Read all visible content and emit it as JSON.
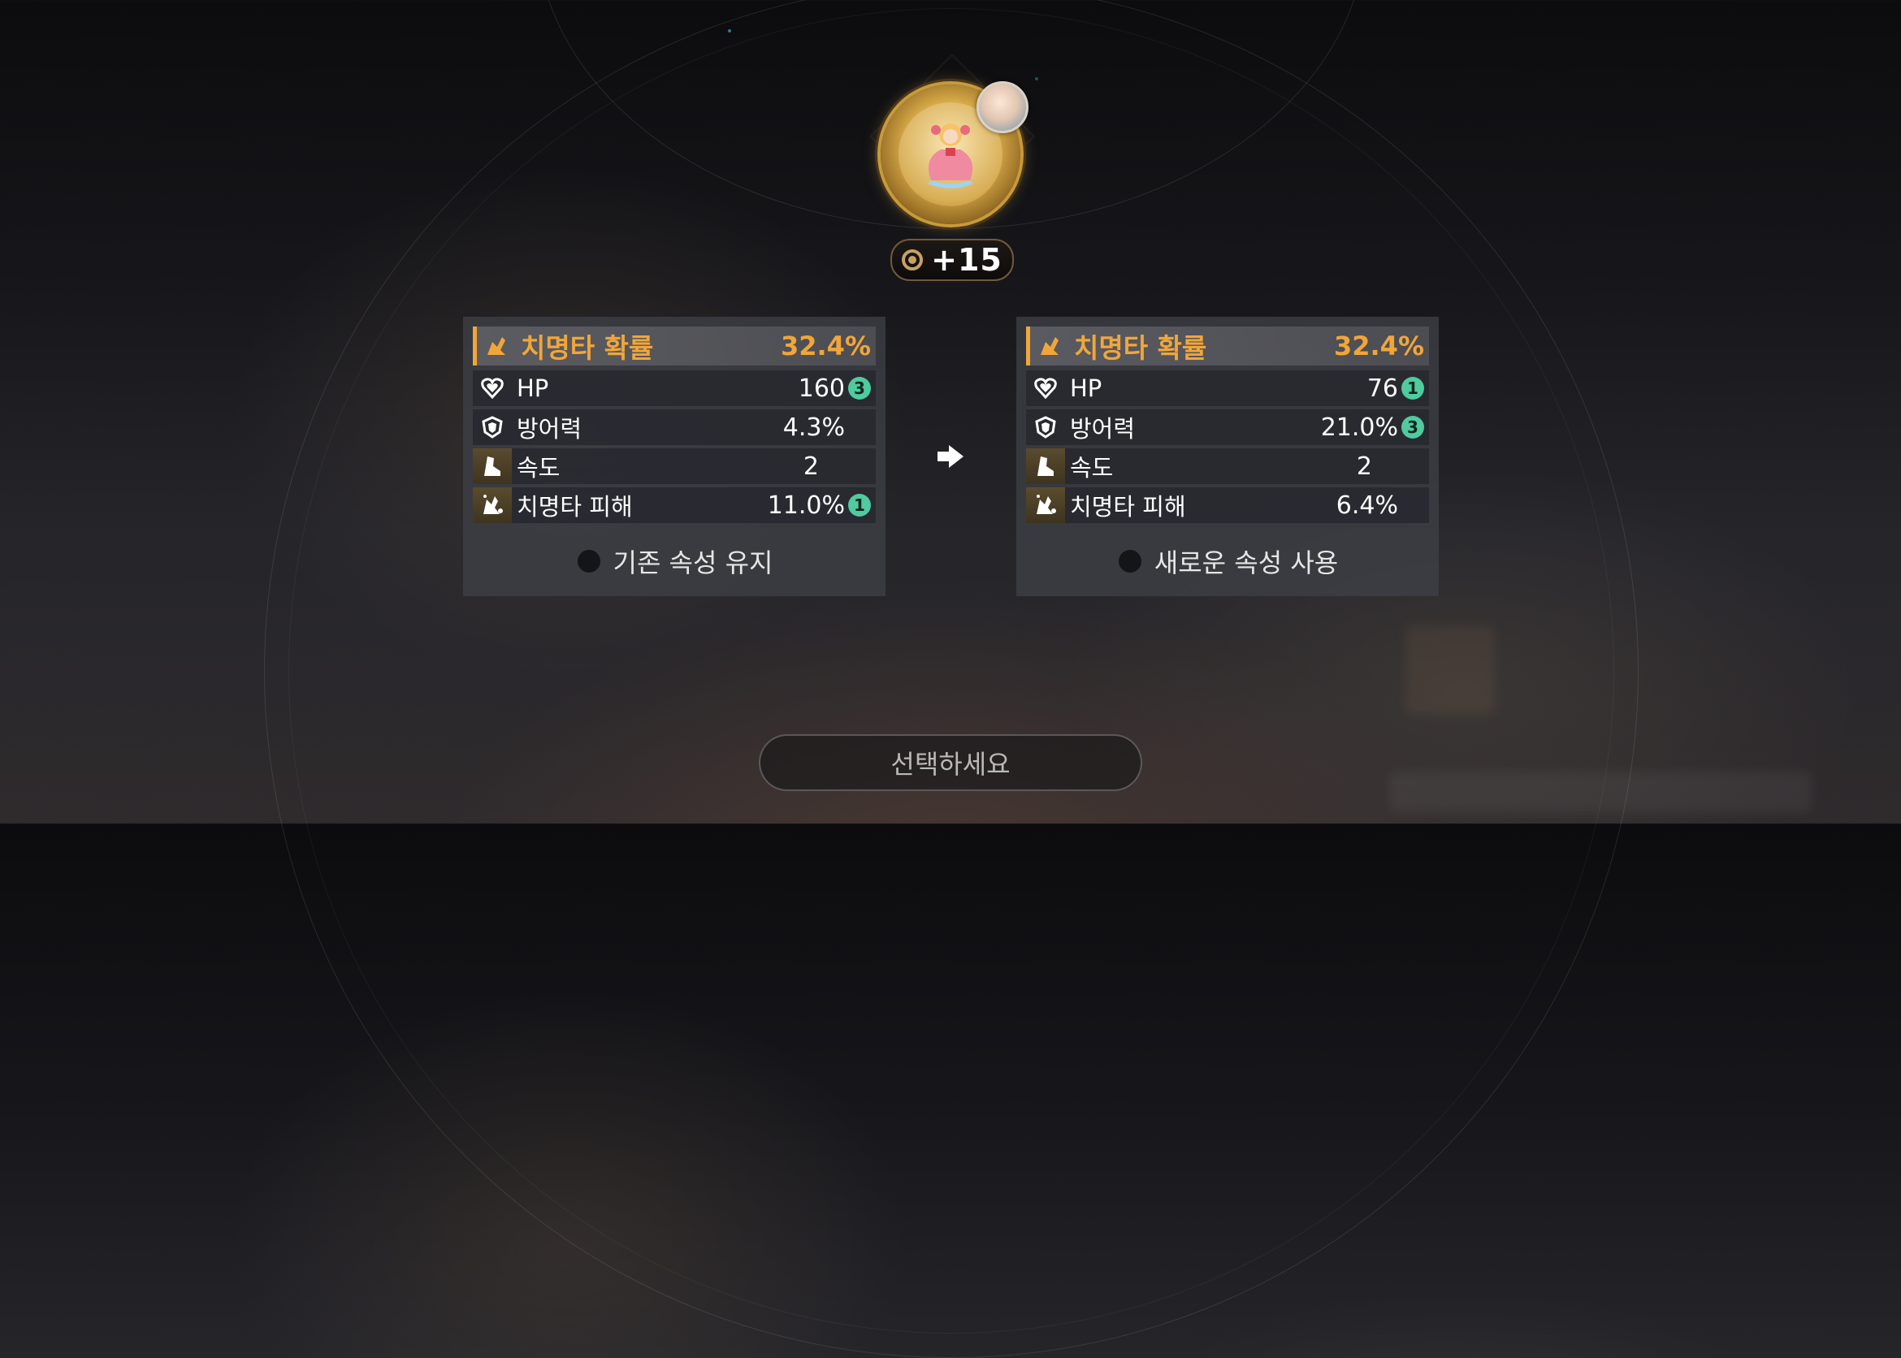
{
  "equipment": {
    "enhance_level": "+15",
    "emblem_icon": "gold-artifact-icon",
    "avatar_icon": "hero-portrait-icon"
  },
  "current_panel": {
    "main_stat": {
      "label": "치명타 확률",
      "value": "32.4%",
      "icon": "crit-chance-icon"
    },
    "substats": [
      {
        "label": "HP",
        "value": "160",
        "rolls": "3",
        "icon": "heart-icon"
      },
      {
        "label": "방어력",
        "value": "4.3%",
        "rolls": "",
        "icon": "shield-icon"
      },
      {
        "label": "속도",
        "value": "2",
        "rolls": "",
        "icon": "boot-icon"
      },
      {
        "label": "치명타 피해",
        "value": "11.0%",
        "rolls": "1",
        "icon": "crit-damage-icon"
      }
    ],
    "choice_label": "기존 속성 유지"
  },
  "new_panel": {
    "main_stat": {
      "label": "치명타 확률",
      "value": "32.4%",
      "icon": "crit-chance-icon"
    },
    "substats": [
      {
        "label": "HP",
        "value": "76",
        "rolls": "1",
        "icon": "heart-icon"
      },
      {
        "label": "방어력",
        "value": "21.0%",
        "rolls": "3",
        "icon": "shield-icon"
      },
      {
        "label": "속도",
        "value": "2",
        "rolls": "",
        "icon": "boot-icon"
      },
      {
        "label": "치명타 피해",
        "value": "6.4%",
        "rolls": "",
        "icon": "crit-damage-icon"
      }
    ],
    "choice_label": "새로운 속성 사용"
  },
  "select_button": {
    "label": "선택하세요"
  },
  "colors": {
    "accent": "#f1a63a",
    "roll_badge": "#4ecb9f"
  }
}
